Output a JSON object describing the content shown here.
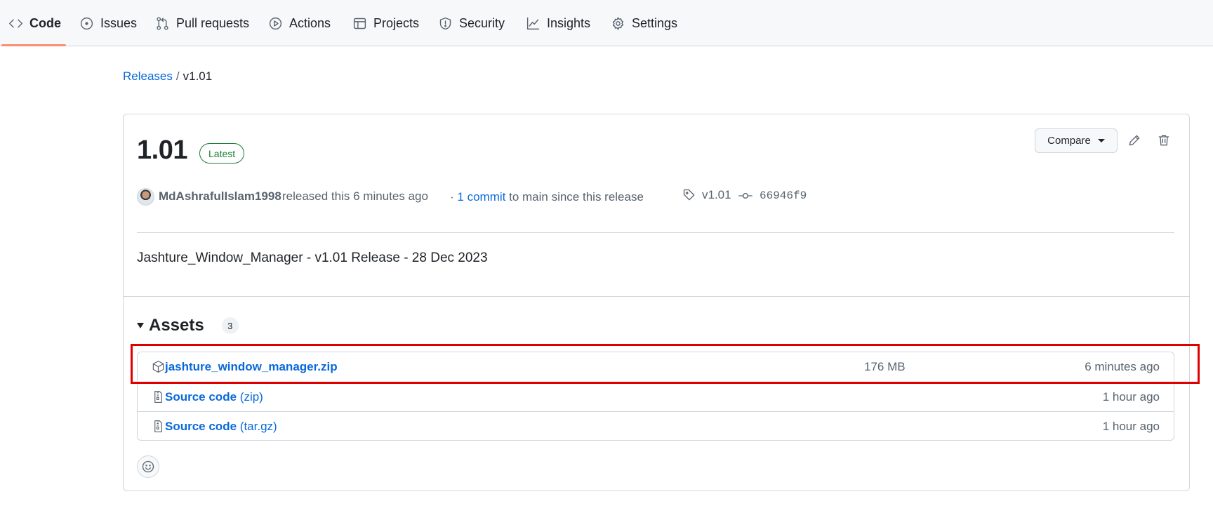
{
  "nav": {
    "tabs": [
      {
        "label": "Code",
        "icon": "code-icon",
        "active": true
      },
      {
        "label": "Issues",
        "icon": "issue-opened-icon"
      },
      {
        "label": "Pull requests",
        "icon": "git-pull-request-icon"
      },
      {
        "label": "Actions",
        "icon": "play-icon"
      },
      {
        "label": "Projects",
        "icon": "table-icon"
      },
      {
        "label": "Security",
        "icon": "shield-icon"
      },
      {
        "label": "Insights",
        "icon": "graph-icon"
      },
      {
        "label": "Settings",
        "icon": "gear-icon"
      }
    ],
    "active_underline_color": "#fd8c73"
  },
  "breadcrumb": {
    "root": "Releases",
    "separator": "/",
    "current": "v1.01"
  },
  "release": {
    "title": "1.01",
    "badge": "Latest",
    "compare_label": "Compare",
    "author": "MdAshrafulIslam1998",
    "released_text": "released this 6 minutes ago",
    "commits_prefix": "·",
    "commits_link": "1 commit",
    "commits_suffix": "to main since this release",
    "tag": "v1.01",
    "commit_sha": "66946f9",
    "body": "Jashture_Window_Manager - v1.01 Release - 28 Dec 2023",
    "colors": {
      "link": "#0969da",
      "badge": "#1a7f37",
      "highlight": "#e00000"
    }
  },
  "assets": {
    "title": "Assets",
    "count": "3",
    "items": [
      {
        "name": "jashture_window_manager.zip",
        "suffix": "",
        "size": "176 MB",
        "time": "6 minutes ago",
        "icon": "package-icon"
      },
      {
        "name": "Source code",
        "suffix": "(zip)",
        "size": "",
        "time": "1 hour ago",
        "icon": "file-zip-icon"
      },
      {
        "name": "Source code",
        "suffix": "(tar.gz)",
        "size": "",
        "time": "1 hour ago",
        "icon": "file-zip-icon"
      }
    ]
  }
}
